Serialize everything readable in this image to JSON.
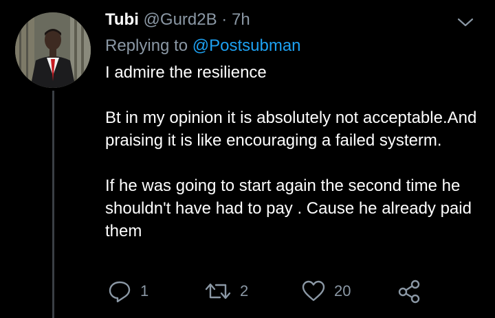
{
  "tweet": {
    "author_name": "Tubi",
    "author_handle": "@Gurd2B",
    "separator": "·",
    "time": "7h",
    "replying_prefix": "Replying to ",
    "replying_to": "@Postsubman",
    "paragraphs": [
      "I admire the resilience",
      "Bt in my opinion it is absolutely not acceptable.And praising it is like encouraging a failed systerm.",
      "If he was going to start again the second time he shouldn't have had to pay . Cause he already paid them"
    ]
  },
  "actions": {
    "reply_count": "1",
    "retweet_count": "2",
    "like_count": "20"
  },
  "icons": {
    "avatar": "profile-photo",
    "more": "chevron-down-icon",
    "reply": "reply-icon",
    "retweet": "retweet-icon",
    "like": "heart-icon",
    "share": "share-icon"
  },
  "colors": {
    "background": "#000000",
    "text": "#ffffff",
    "secondary_text": "#8b98a5",
    "link": "#1da1f2",
    "thread_line": "#3a3f45"
  }
}
